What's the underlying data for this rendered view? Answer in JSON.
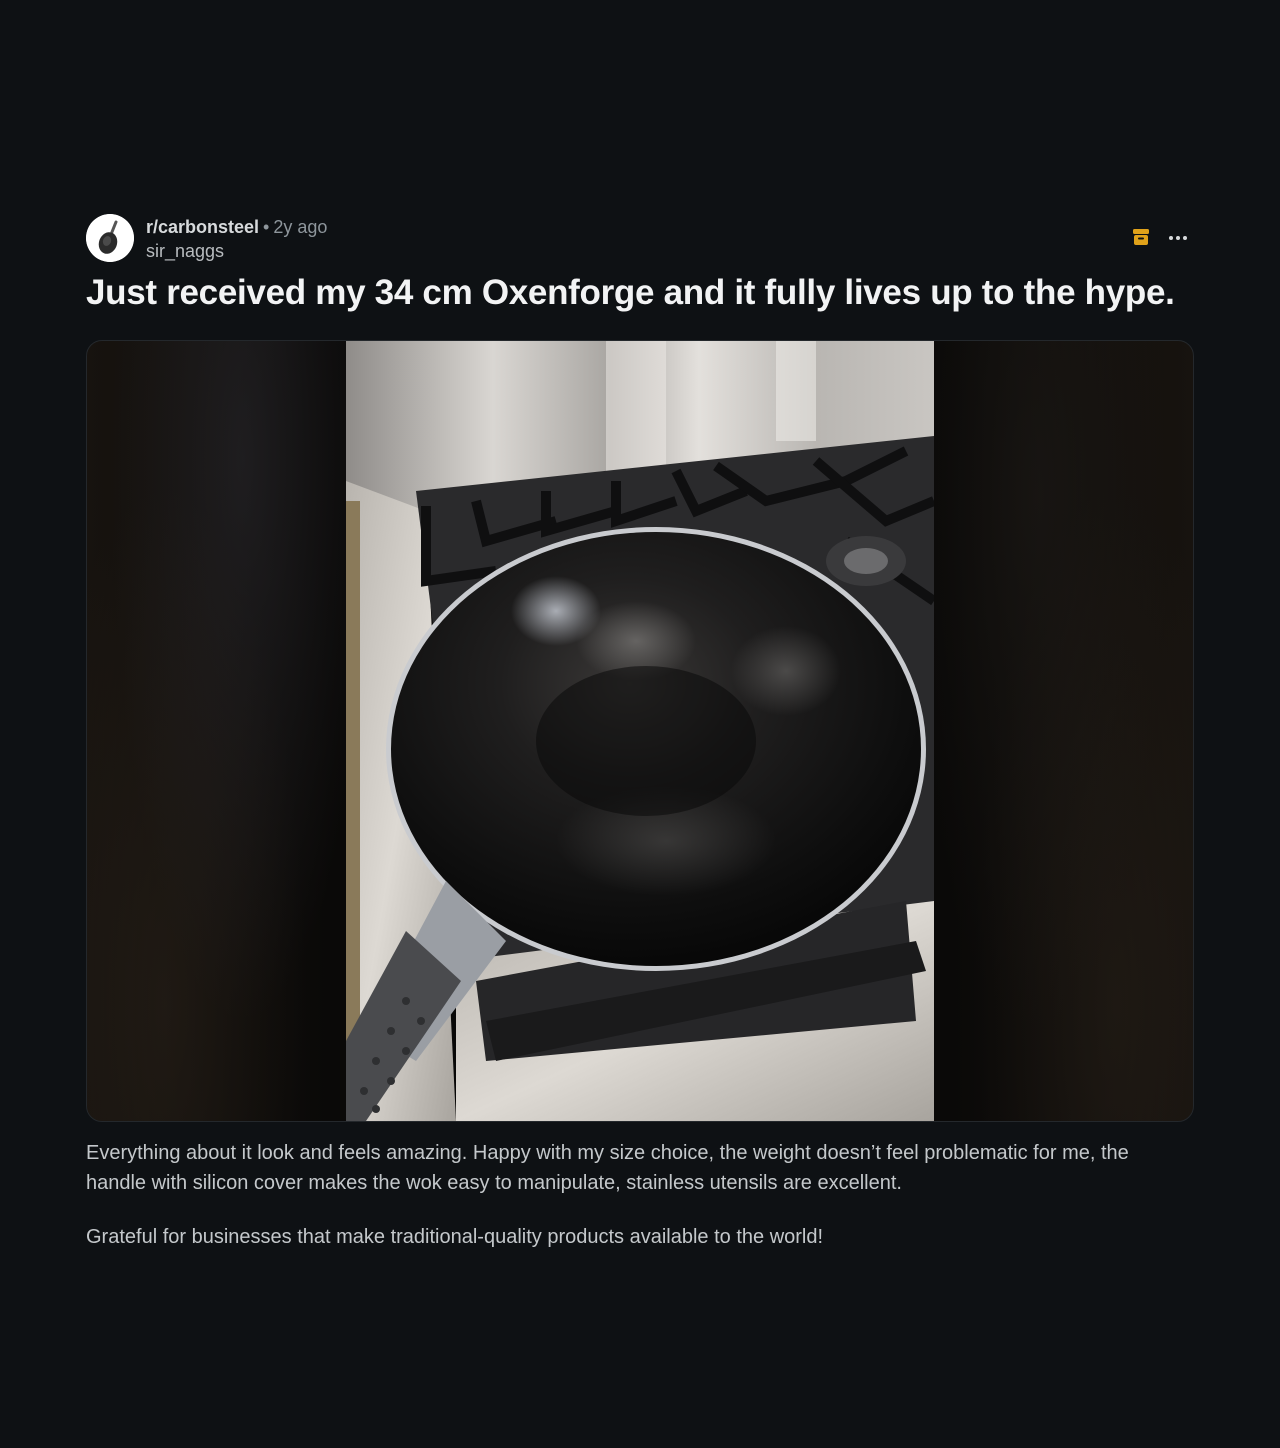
{
  "post": {
    "subreddit": "r/carbonsteel",
    "separator": "•",
    "time_ago": "2y ago",
    "username": "sir_naggs",
    "title": "Just received my 34 cm Oxenforge and it fully lives up to the hype.",
    "image_alt": "Hand-hammered carbon steel wok on a gas stove",
    "paragraphs": [
      "Everything about it look and feels amazing. Happy with my size choice, the weight doesn’t feel problematic for me, the handle with silicon cover makes the wok easy to manipulate, stainless utensils are excellent.",
      "Grateful for businesses that make traditional-quality products available to the world!"
    ]
  },
  "icons": {
    "avatar": "wok-avatar-icon",
    "archive": "archive-icon",
    "more": "more-options-icon"
  },
  "colors": {
    "background": "#0e1114",
    "archive_icon": "#e0a21a",
    "title": "#f2f3f4",
    "muted": "#8e969c"
  }
}
